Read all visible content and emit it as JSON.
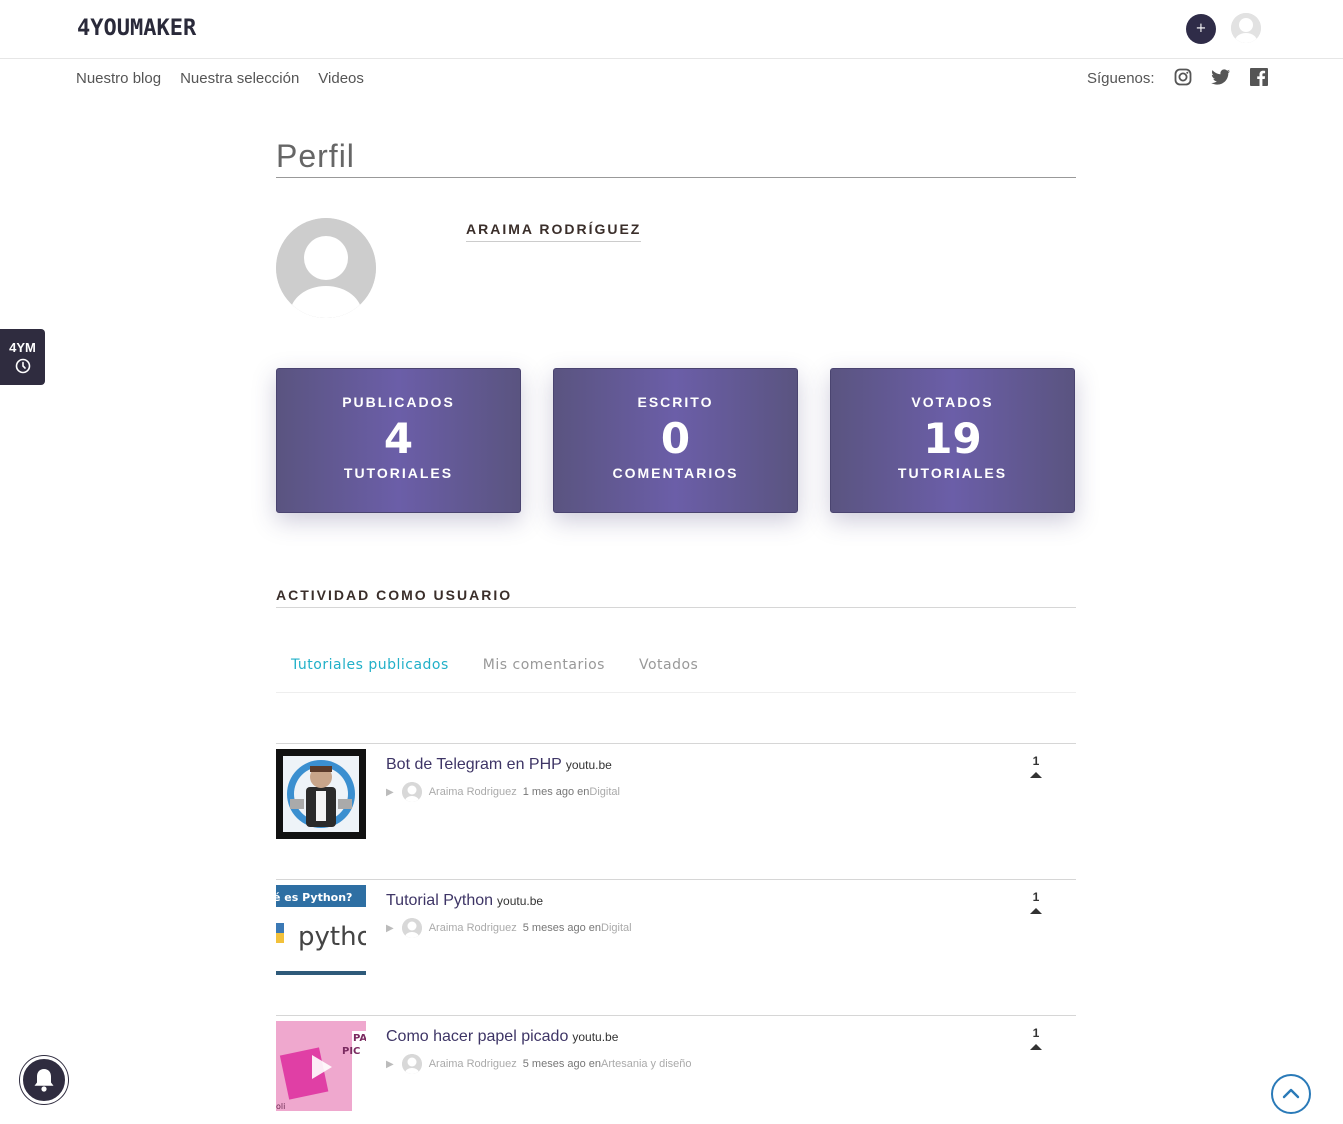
{
  "header": {
    "logo": "4YOUMAKER",
    "plus_label": "+",
    "nav": [
      "Nuestro blog",
      "Nuestra selección",
      "Videos"
    ],
    "follow_label": "Síguenos:",
    "social_icons": [
      "instagram-icon",
      "twitter-icon",
      "facebook-icon"
    ]
  },
  "side_tab": {
    "label": "4YM"
  },
  "profile": {
    "page_title": "Perfil",
    "username": "ARAIMA RODRÍGUEZ"
  },
  "stats": [
    {
      "label": "PUBLICADOS",
      "value": "4",
      "sub": "TUTORIALES"
    },
    {
      "label": "ESCRITO",
      "value": "0",
      "sub": "COMENTARIOS"
    },
    {
      "label": "VOTADOS",
      "value": "19",
      "sub": "TUTORIALES"
    }
  ],
  "activity": {
    "title": "ACTIVIDAD COMO USUARIO",
    "tabs": [
      "Tutoriales publicados",
      "Mis comentarios",
      "Votados"
    ],
    "active_tab": 0,
    "items": [
      {
        "title": "Bot de Telegram en PHP",
        "source": "youtu.be",
        "author": "Araima Rodriguez",
        "time": "1 mes ago en",
        "category": "Digital",
        "votes": "1"
      },
      {
        "title": "Tutorial Python",
        "source": "youtu.be",
        "author": "Araima Rodriguez",
        "time": "5 meses ago en",
        "category": "Digital",
        "votes": "1",
        "thumb_text_top": "é es Python?",
        "thumb_text_main": "pytho"
      },
      {
        "title": "Como hacer papel picado",
        "source": "youtu.be",
        "author": "Araima Rodriguez",
        "time": "5 meses ago en",
        "category": "Artesania y diseño",
        "votes": "1",
        "thumb_text_top": "PA",
        "thumb_text_main": "PIC",
        "thumb_text_bottom": "oli"
      }
    ]
  },
  "colors": {
    "accent_tab": "#21b0c8",
    "card_purple": "#6b5ea8",
    "title_purple": "#3e3566",
    "dark_navy": "#2f2c48"
  }
}
